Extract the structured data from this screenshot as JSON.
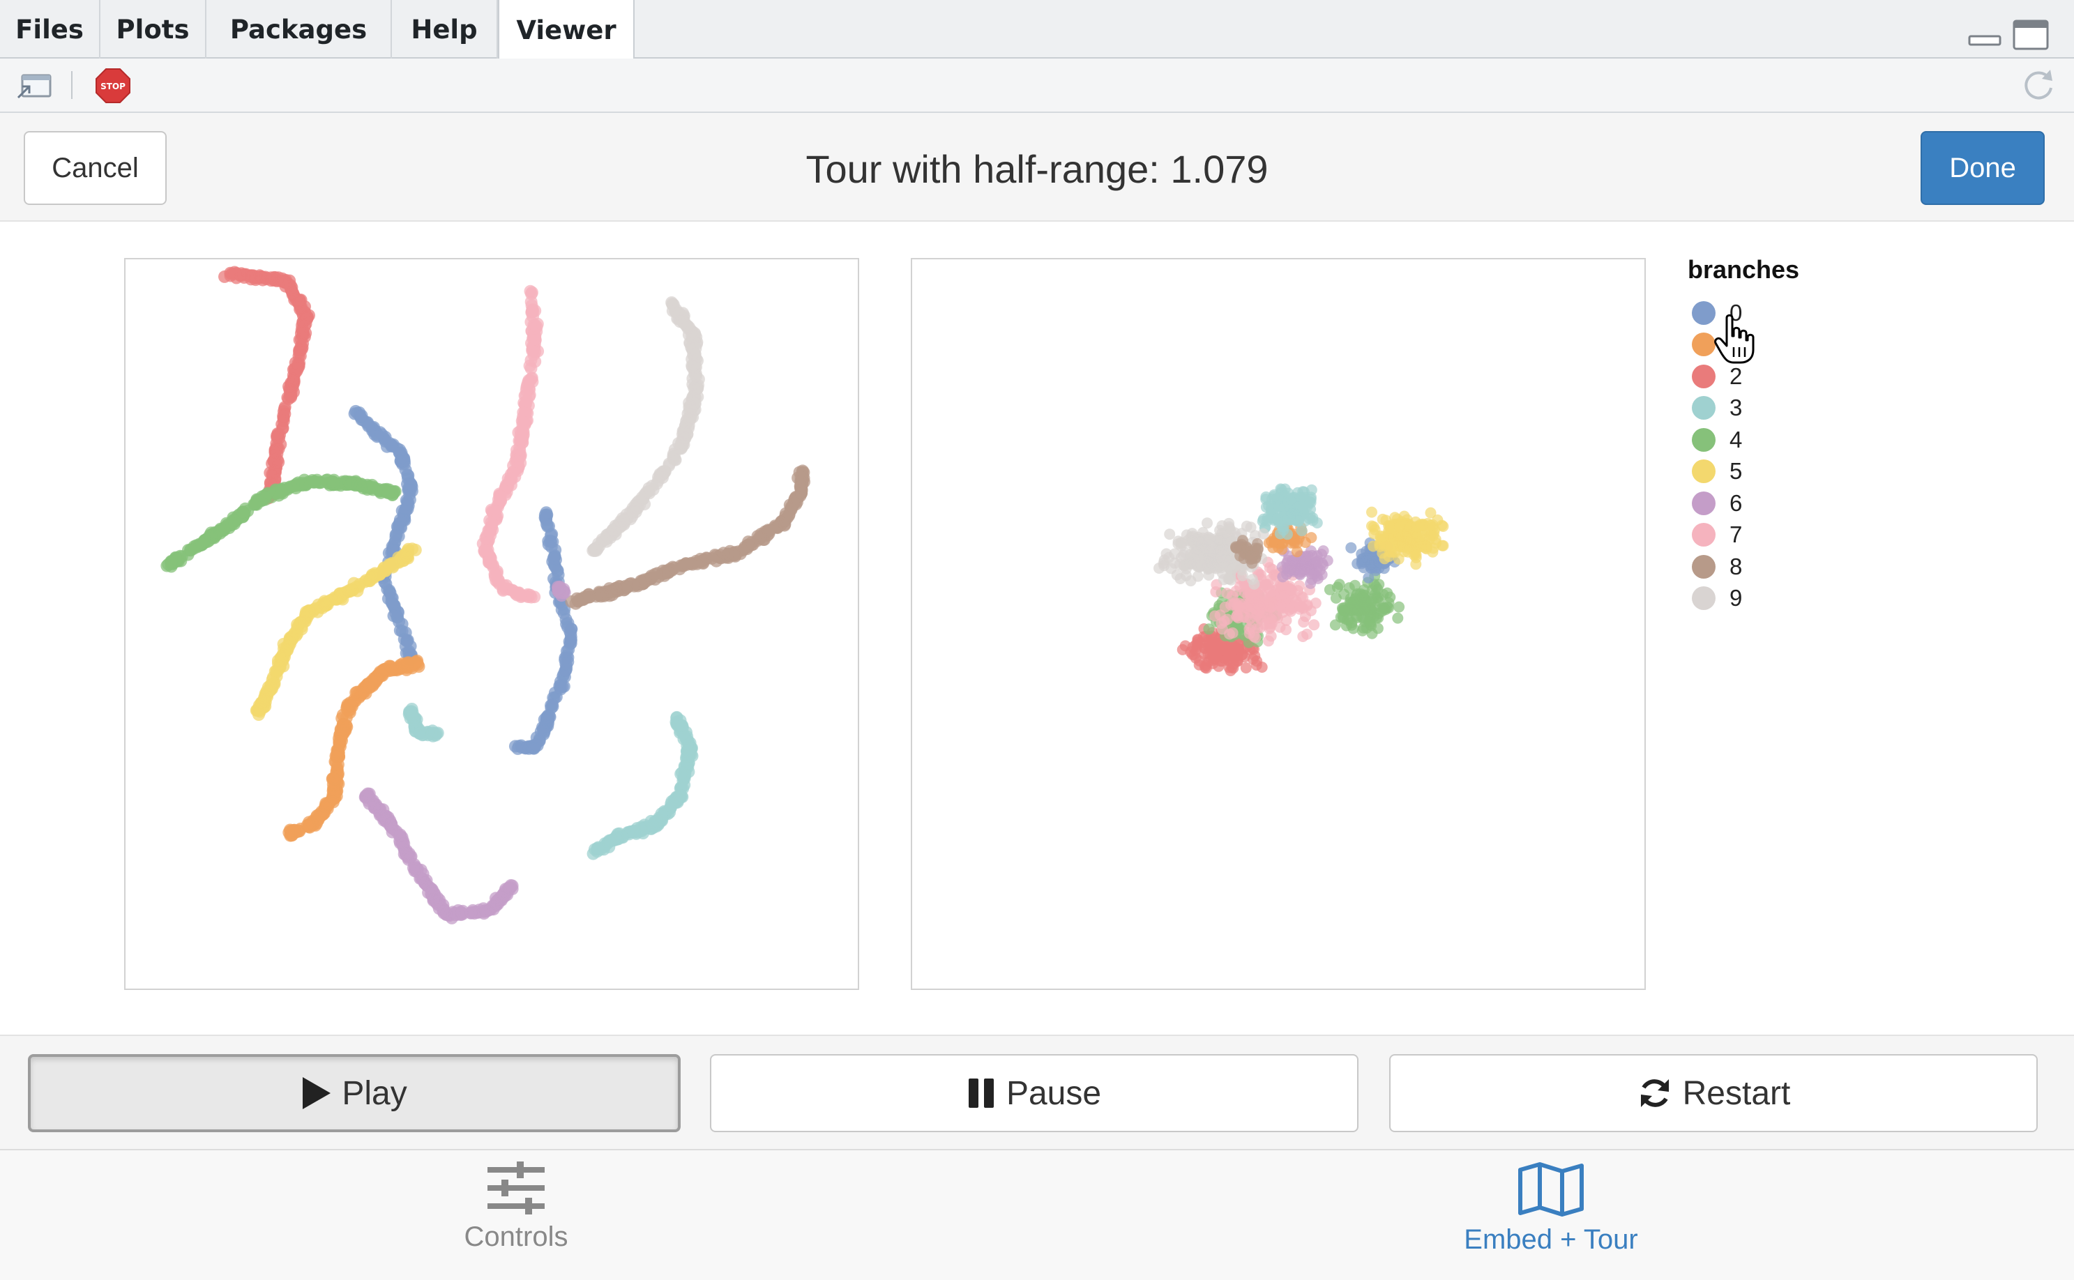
{
  "tabs": [
    {
      "label": "Files",
      "active": false
    },
    {
      "label": "Plots",
      "active": false
    },
    {
      "label": "Packages",
      "active": false
    },
    {
      "label": "Help",
      "active": false
    },
    {
      "label": "Viewer",
      "active": true
    }
  ],
  "header": {
    "cancel_label": "Cancel",
    "title": "Tour with half-range: 1.079",
    "done_label": "Done"
  },
  "legend": {
    "title": "branches",
    "items": [
      {
        "label": "0",
        "color": "#7f9ccb"
      },
      {
        "label": "1",
        "color": "#f0a05a"
      },
      {
        "label": "2",
        "color": "#e97b7b"
      },
      {
        "label": "3",
        "color": "#9fd1d0"
      },
      {
        "label": "4",
        "color": "#86c17a"
      },
      {
        "label": "5",
        "color": "#f3d86e"
      },
      {
        "label": "6",
        "color": "#c49dc8"
      },
      {
        "label": "7",
        "color": "#f5b3be"
      },
      {
        "label": "8",
        "color": "#b79a89"
      },
      {
        "label": "9",
        "color": "#d9d4d2"
      }
    ]
  },
  "playback": {
    "play_label": "Play",
    "pause_label": "Pause",
    "restart_label": "Restart"
  },
  "nav": {
    "controls_label": "Controls",
    "embed_label": "Embed + Tour"
  },
  "colors": {
    "accent": "#3a80c1",
    "nav_active": "#3a7fc0",
    "nav_inactive": "#888888"
  }
}
